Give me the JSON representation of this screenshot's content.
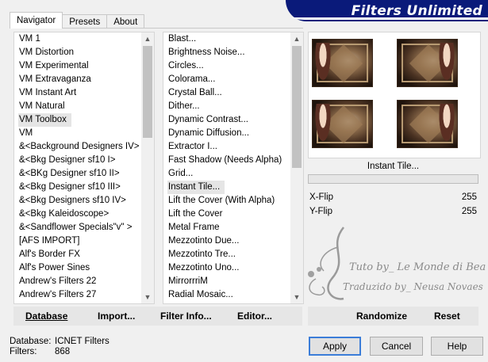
{
  "tabs": [
    "Navigator",
    "Presets",
    "About"
  ],
  "banner_title": "Filters Unlimited",
  "categories": [
    "VM 1",
    "VM Distortion",
    "VM Experimental",
    "VM Extravaganza",
    "VM Instant Art",
    "VM Natural",
    "VM Toolbox",
    "VM",
    "&<Background Designers IV>",
    "&<Bkg Designer sf10 I>",
    "&<BKg Designer sf10 II>",
    "&<Bkg Designer sf10 III>",
    "&<Bkg Designers sf10 IV>",
    "&<Bkg Kaleidoscope>",
    "&<Sandflower Specials\"v\" >",
    "[AFS IMPORT]",
    "Alf's Border FX",
    "Alf's Power Sines",
    "Andrew's Filters 22",
    "Andrew's Filters 27"
  ],
  "selected_category": "VM Toolbox",
  "filters": [
    "Blast...",
    "Brightness Noise...",
    "Circles...",
    "Colorama...",
    "Crystal Ball...",
    "Dither...",
    "Dynamic Contrast...",
    "Dynamic Diffusion...",
    "Extractor I...",
    "Fast Shadow (Needs Alpha)",
    "Grid...",
    "Instant Tile...",
    "Lift the Cover (With Alpha)",
    "Lift the Cover",
    "Metal Frame",
    "Mezzotinto Due...",
    "Mezzotinto Tre...",
    "Mezzotinto Uno...",
    "MirrorrriM",
    "Radial Mosaic..."
  ],
  "selected_filter": "Instant Tile...",
  "filter_name": "Instant Tile...",
  "params": [
    {
      "label": "X-Flip",
      "value": "255"
    },
    {
      "label": "Y-Flip",
      "value": "255"
    }
  ],
  "watermark": {
    "line1": "Tuto by_ Le Monde di Bea",
    "line2": "Traduzido by_ Neusa Novaes"
  },
  "buttons": {
    "database": "Database",
    "import": "Import...",
    "filter_info": "Filter Info...",
    "editor": "Editor...",
    "randomize": "Randomize",
    "reset": "Reset",
    "apply": "Apply",
    "cancel": "Cancel",
    "help": "Help"
  },
  "status": {
    "database_label": "Database:",
    "database_value": "ICNET Filters",
    "filters_label": "Filters:",
    "filters_value": "868"
  },
  "colors": {
    "banner": "#0a1a7a",
    "default_button_border": "#3b7dd8",
    "selection": "#e5e5e5"
  },
  "icons": {
    "scroll_up": "▲",
    "scroll_down": "▼"
  }
}
